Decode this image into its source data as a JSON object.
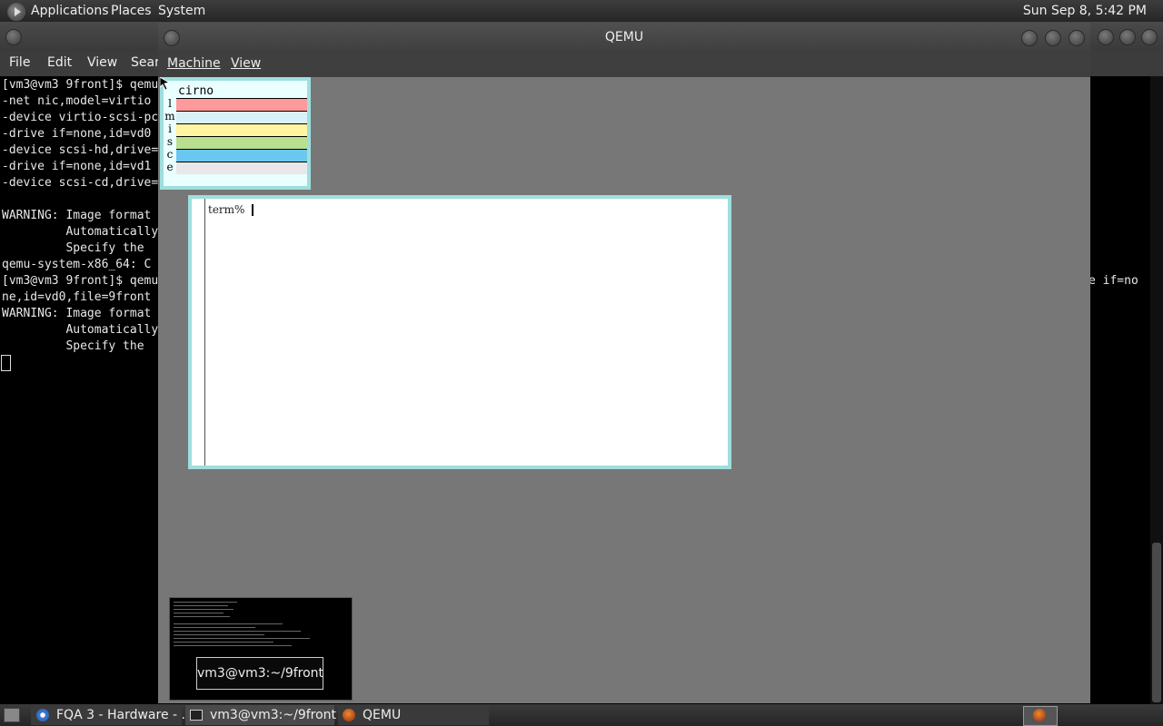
{
  "top_panel": {
    "menus": [
      "Applications",
      "Places",
      "System"
    ],
    "clock": "Sun Sep  8,  5:42 PM"
  },
  "terminal": {
    "menu": [
      "File",
      "Edit",
      "View",
      "Searc"
    ],
    "lines": [
      "[vm3@vm3 9front]$ qemu",
      "-net nic,model=virtio",
      "-device virtio-scsi-pc",
      "-drive if=none,id=vd0",
      "-device scsi-hd,drive=",
      "-drive if=none,id=vd1",
      "-device scsi-cd,drive=",
      "",
      "WARNING: Image format",
      "         Automatically",
      "         Specify the",
      "qemu-system-x86_64: C",
      "[vm3@vm3 9front]$ qemu",
      "ne,id=vd0,file=9front",
      "WARNING: Image format",
      "         Automatically",
      "         Specify the"
    ],
    "right_fragment": "e if=no"
  },
  "qemu": {
    "title": "QEMU",
    "menu": [
      "Machine",
      "View"
    ],
    "stats": {
      "name": "cirno",
      "letters": [
        "l",
        "m",
        "i",
        "s",
        "c",
        "e"
      ]
    },
    "rio_term": {
      "prompt": "term%"
    }
  },
  "switcher": {
    "label": "vm3@vm3:~/9front"
  },
  "taskbar": {
    "tasks": [
      "FQA 3 - Hardware - ...",
      "vm3@vm3:~/9front",
      "QEMU"
    ]
  },
  "colors": {
    "rio_border": "#9fdede",
    "stat_colors": [
      "#ff9a9a",
      "#d8f0f8",
      "#fff4a0",
      "#b8e090",
      "#6ac8f0",
      "#e8e8e8"
    ]
  }
}
